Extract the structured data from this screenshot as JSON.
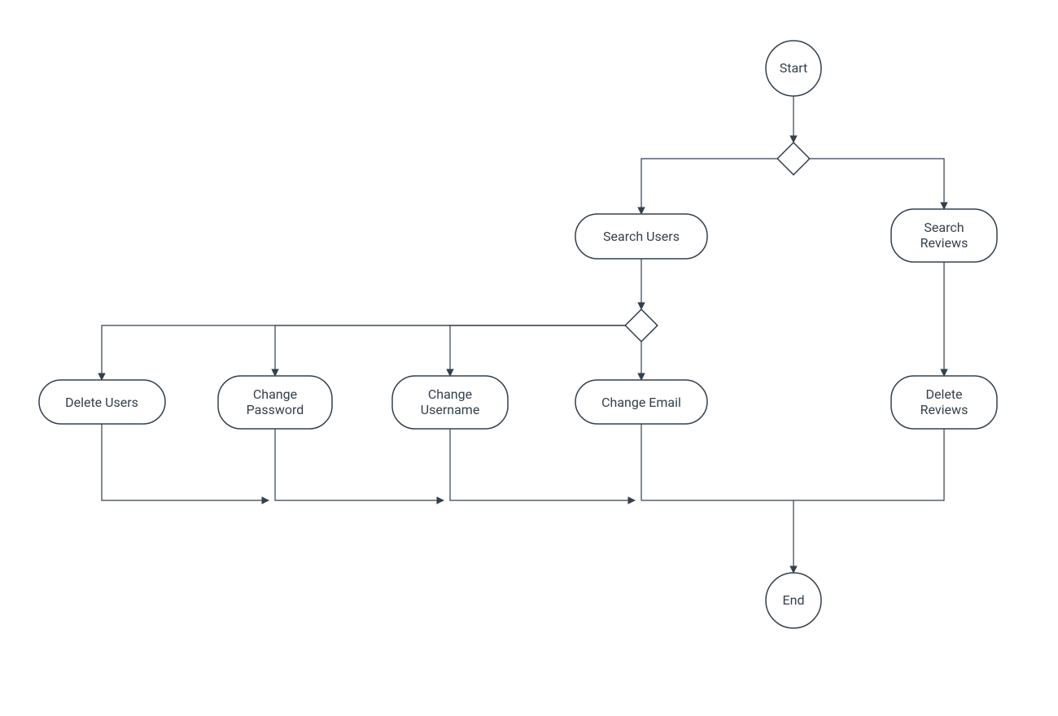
{
  "diagram": {
    "type": "flowchart",
    "nodes": {
      "start": {
        "label": "Start",
        "shape": "circle"
      },
      "decision1": {
        "label": "",
        "shape": "diamond"
      },
      "search_users": {
        "label": "Search Users",
        "shape": "rounded"
      },
      "search_reviews": {
        "label": "Search\nReviews",
        "shape": "rounded"
      },
      "decision2": {
        "label": "",
        "shape": "diamond"
      },
      "delete_users": {
        "label": "Delete Users",
        "shape": "rounded"
      },
      "change_password": {
        "label": "Change\nPassword",
        "shape": "rounded"
      },
      "change_username": {
        "label": "Change\nUsername",
        "shape": "rounded"
      },
      "change_email": {
        "label": "Change Email",
        "shape": "rounded"
      },
      "delete_reviews": {
        "label": "Delete\nReviews",
        "shape": "rounded"
      },
      "end": {
        "label": "End",
        "shape": "circle"
      }
    },
    "edges": [
      [
        "start",
        "decision1"
      ],
      [
        "decision1",
        "search_users"
      ],
      [
        "decision1",
        "search_reviews"
      ],
      [
        "search_users",
        "decision2"
      ],
      [
        "decision2",
        "delete_users"
      ],
      [
        "decision2",
        "change_password"
      ],
      [
        "decision2",
        "change_username"
      ],
      [
        "decision2",
        "change_email"
      ],
      [
        "search_reviews",
        "delete_reviews"
      ],
      [
        "delete_users",
        "merge"
      ],
      [
        "change_password",
        "merge"
      ],
      [
        "change_username",
        "merge"
      ],
      [
        "change_email",
        "merge"
      ],
      [
        "delete_reviews",
        "merge"
      ],
      [
        "merge",
        "end"
      ]
    ]
  }
}
